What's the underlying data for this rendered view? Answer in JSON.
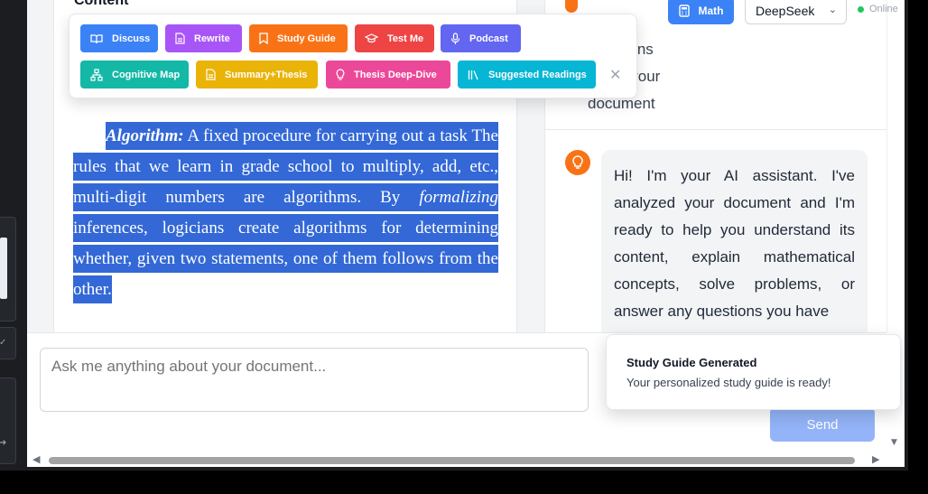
{
  "document": {
    "section_heading": "Content",
    "paragraph_term": "Algorithm:",
    "paragraph_part1": " A fixed procedure for carrying out a task The rules that we learn in grade school to multiply, add, etc., multi-digit numbers are algorithms. By ",
    "paragraph_emph": "formalizing",
    "paragraph_part2": " inferences, logicians create algorithms for determining whether, given two statements, one of them follows from the other."
  },
  "action_toolbar": {
    "buttons": [
      {
        "label": "Discuss",
        "icon": "book-open-icon",
        "color": "#3b82f6"
      },
      {
        "label": "Rewrite",
        "icon": "document-icon",
        "color": "#a855f7"
      },
      {
        "label": "Study Guide",
        "icon": "bookmark-icon",
        "color": "#f97316"
      },
      {
        "label": "Test Me",
        "icon": "graduation-cap-icon",
        "color": "#ef4444"
      },
      {
        "label": "Podcast",
        "icon": "microphone-icon",
        "color": "#6366f1"
      },
      {
        "label": "Cognitive Map",
        "icon": "network-icon",
        "color": "#14b8a6"
      },
      {
        "label": "Summary+Thesis",
        "icon": "document-icon",
        "color": "#eab308"
      },
      {
        "label": "Thesis Deep-Dive",
        "icon": "lightbulb-icon",
        "color": "#ec4899"
      },
      {
        "label": "Suggested Readings",
        "icon": "library-icon",
        "color": "#06b6d4"
      }
    ],
    "close_glyph": "✕"
  },
  "header": {
    "math_label": "Math",
    "model_selected": "DeepSeek",
    "status_text": "Online"
  },
  "chat": {
    "previous_message": "Ask questions about your document",
    "assistant_message": "Hi! I'm your AI assistant. I've analyzed your document and I'm ready to help you understand its content, explain mathematical concepts, solve problems, or answer any questions you have"
  },
  "input": {
    "placeholder": "Ask me anything about your document...",
    "send_label": "Send"
  },
  "toast": {
    "title": "Study Guide Generated",
    "body": "Your personalized study guide is ready!"
  },
  "colors": {
    "selection": "#3368d6",
    "assistant_avatar": "#f97316",
    "send_disabled": "#93b4f8",
    "status_online": "#22c55e"
  }
}
